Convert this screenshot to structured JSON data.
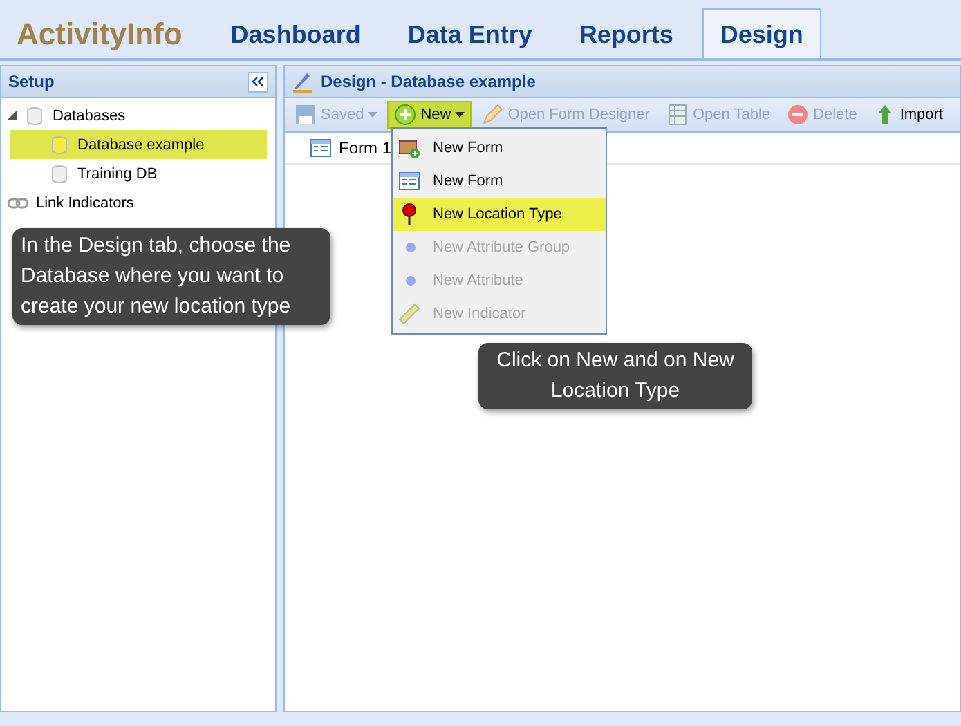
{
  "header": {
    "logo": "ActivityInfo",
    "tabs": [
      {
        "label": "Dashboard",
        "selected": false
      },
      {
        "label": "Data Entry",
        "selected": false
      },
      {
        "label": "Reports",
        "selected": false
      },
      {
        "label": "Design",
        "selected": true
      }
    ]
  },
  "sidebar": {
    "title": "Setup",
    "tree": [
      {
        "label": "Databases",
        "kind": "folder",
        "expanded": true,
        "selected": false,
        "children": [
          {
            "label": "Database example",
            "kind": "database",
            "selected": true
          },
          {
            "label": "Training DB",
            "kind": "database",
            "selected": false
          }
        ]
      },
      {
        "label": "Link Indicators",
        "kind": "link",
        "selected": false
      }
    ]
  },
  "main": {
    "title": "Design - Database example",
    "toolbar": [
      {
        "label": "Saved",
        "kind": "save",
        "disabled": true,
        "dropdown": true,
        "highlighted": false
      },
      {
        "label": "New",
        "kind": "new",
        "disabled": false,
        "dropdown": true,
        "highlighted": true
      },
      {
        "label": "Open Form Designer",
        "kind": "pencil",
        "disabled": true,
        "dropdown": false,
        "highlighted": false
      },
      {
        "label": "Open Table",
        "kind": "table",
        "disabled": true,
        "dropdown": false,
        "highlighted": false
      },
      {
        "label": "Delete",
        "kind": "delete",
        "disabled": true,
        "dropdown": false,
        "highlighted": false
      },
      {
        "label": "Import",
        "kind": "import",
        "disabled": false,
        "dropdown": false,
        "highlighted": false
      }
    ],
    "items": [
      {
        "label": "Form 1"
      }
    ],
    "menu": [
      {
        "label": "New Form",
        "kind": "form-add",
        "disabled": false,
        "selected": false
      },
      {
        "label": "New Form",
        "kind": "form",
        "disabled": false,
        "selected": false
      },
      {
        "label": "New Location Type",
        "kind": "pin",
        "disabled": false,
        "selected": true
      },
      {
        "label": "New Attribute Group",
        "kind": "dot",
        "disabled": true,
        "selected": false
      },
      {
        "label": "New Attribute",
        "kind": "dot",
        "disabled": true,
        "selected": false
      },
      {
        "label": "New Indicator",
        "kind": "ruler",
        "disabled": true,
        "selected": false
      }
    ]
  },
  "callouts": [
    {
      "text": "In the Design tab, choose the Database where you want to create your new location type",
      "kind": "left"
    },
    {
      "text": "Click on New and on New Location Type",
      "kind": "center"
    }
  ]
}
